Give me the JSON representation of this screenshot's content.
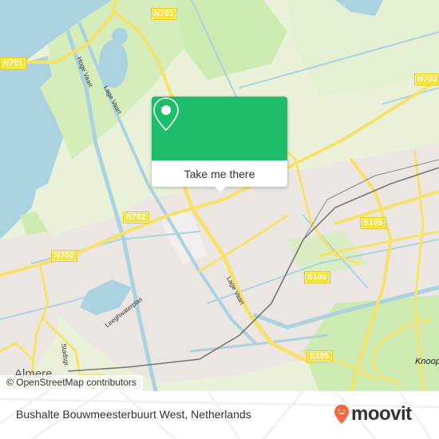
{
  "map": {
    "road_labels": [
      {
        "id": "n701-top",
        "text": "N701"
      },
      {
        "id": "n701-left",
        "text": "N701"
      },
      {
        "id": "n702-right",
        "text": "N702"
      },
      {
        "id": "n702-center",
        "text": "N702"
      },
      {
        "id": "n702-left",
        "text": "N702"
      },
      {
        "id": "s105-upper",
        "text": "S105"
      },
      {
        "id": "s105-mid",
        "text": "S105"
      },
      {
        "id": "s105-lower",
        "text": "S105"
      }
    ],
    "water_labels": {
      "hoge_vaart": "Hoge Vaart",
      "lage_vaart_top": "Lage Vaart",
      "lage_vaart_mid": "Lage Vaart",
      "leeghwaterplas": "Leeghwaterplas",
      "stadsgracht": "Stadsgr."
    },
    "place_labels": {
      "city": "Almere",
      "knooppunt": "Knoop"
    },
    "colors": {
      "water": "#aad3df",
      "park": "#cdebb0",
      "land": "#e9f2d9",
      "urban": "#ece6e2",
      "road": "#f7e16b",
      "rail": "#777777"
    }
  },
  "popup": {
    "icon": "location-pin-icon",
    "button_label": "Take me there",
    "color": "#1dbd6b"
  },
  "attribution": "© OpenStreetMap contributors",
  "footer": {
    "title": "Bushalte Bouwmeesterbuurt West, Netherlands",
    "brand": "moovit",
    "brand_color": "#f26a3d"
  }
}
